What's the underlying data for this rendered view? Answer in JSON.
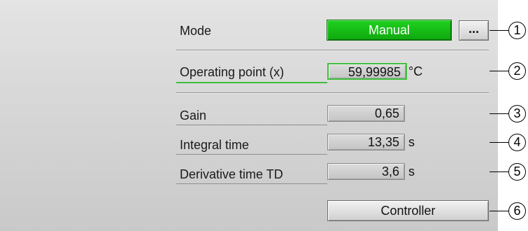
{
  "mode": {
    "label": "Mode",
    "value": "Manual",
    "more_label": "..."
  },
  "operating_point": {
    "label": "Operating point (x)",
    "value": "59,99985",
    "unit": "°C"
  },
  "gain": {
    "label": "Gain",
    "value": "0,65"
  },
  "integral_time": {
    "label": "Integral time",
    "value": "13,35",
    "unit": "s"
  },
  "derivative_time": {
    "label": "Derivative time TD",
    "value": "3,6",
    "unit": "s"
  },
  "controller_button": {
    "label": "Controller"
  },
  "callouts": [
    "1",
    "2",
    "3",
    "4",
    "5",
    "6"
  ],
  "colors": {
    "mode_active": "#22c422",
    "operating_point_border": "#3fbf3f"
  }
}
